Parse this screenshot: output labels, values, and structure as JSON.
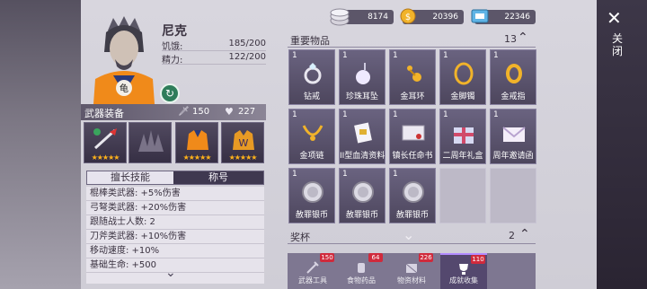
{
  "character": {
    "name": "尼克",
    "hunger_label": "饥饿:",
    "hunger_value": "185/200",
    "energy_label": "精力:",
    "energy_value": "122/200"
  },
  "equipment": {
    "title": "武器装备",
    "attack": "150",
    "health": "227",
    "slots": [
      {
        "stars": "★★★★★"
      },
      {
        "stars": ""
      },
      {
        "stars": "★★★★★"
      },
      {
        "stars": "★★★★★"
      }
    ]
  },
  "skills": {
    "tab_skill": "擅长技能",
    "tab_title": "称号",
    "rows": [
      "棍棒类武器: +5%伤害",
      "弓弩类武器: +20%伤害",
      "跟随战士人数: 2",
      "刀斧类武器: +10%伤害",
      "移动速度: +10%",
      "基础生命: +500"
    ]
  },
  "currency": {
    "silver": "8174",
    "gold": "20396",
    "ticket": "22346"
  },
  "important_items": {
    "title": "重要物品",
    "count": "13",
    "items": [
      {
        "qty": "1",
        "name": "钻戒",
        "icon": "diamond-ring"
      },
      {
        "qty": "1",
        "name": "珍珠耳坠",
        "icon": "pearl-earring"
      },
      {
        "qty": "1",
        "name": "金耳环",
        "icon": "gold-earring"
      },
      {
        "qty": "1",
        "name": "金脚镯",
        "icon": "gold-anklet"
      },
      {
        "qty": "1",
        "name": "金戒指",
        "icon": "gold-ring"
      },
      {
        "qty": "1",
        "name": "金项链",
        "icon": "gold-necklace"
      },
      {
        "qty": "1",
        "name": "II型血清资料",
        "icon": "serum-document"
      },
      {
        "qty": "1",
        "name": "镇长任命书",
        "icon": "appointment-letter"
      },
      {
        "qty": "1",
        "name": "二周年礼盒",
        "icon": "gift-box"
      },
      {
        "qty": "1",
        "name": "周年邀请函",
        "icon": "invitation-letter"
      },
      {
        "qty": "1",
        "name": "赦罪银币",
        "icon": "silver-coin"
      },
      {
        "qty": "1",
        "name": "赦罪银币",
        "icon": "silver-coin"
      },
      {
        "qty": "1",
        "name": "赦罪银币",
        "icon": "silver-coin"
      }
    ]
  },
  "trophy": {
    "title": "奖杯",
    "count": "2"
  },
  "bottom_tabs": [
    {
      "label": "武器工具",
      "count": "150"
    },
    {
      "label": "食物药品",
      "count": "64"
    },
    {
      "label": "物资材料",
      "count": "226"
    },
    {
      "label": "成就收集",
      "count": "110"
    }
  ],
  "close_label": "关闭",
  "colors": {
    "accent": "#b38cff",
    "star": "#ffb21a",
    "badge": "#d02a3c"
  }
}
